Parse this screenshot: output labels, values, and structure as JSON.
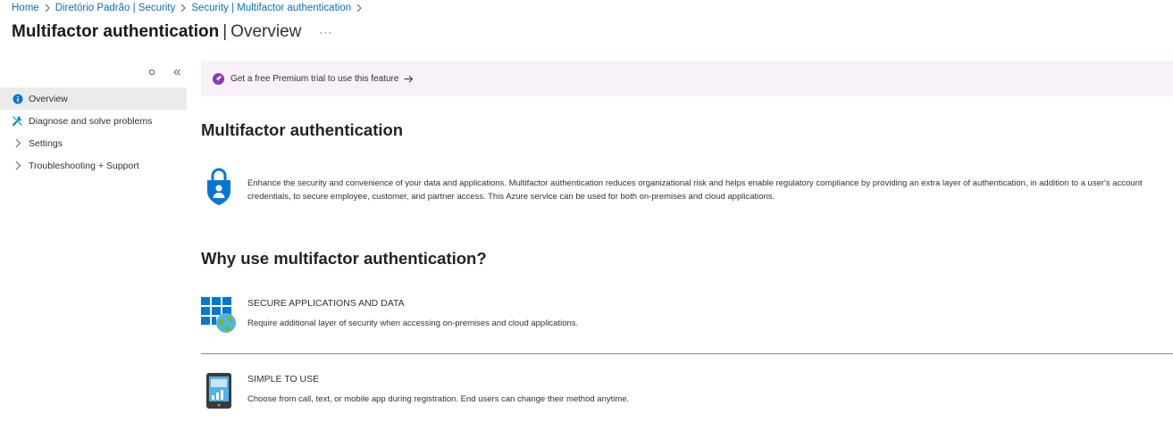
{
  "breadcrumb": {
    "items": [
      "Home",
      "Diretório Padrão | Security",
      "Security | Multifactor authentication"
    ]
  },
  "header": {
    "title": "Multifactor authentication",
    "separator": "|",
    "subtitle": "Overview",
    "more": "···"
  },
  "sidebar": {
    "controls": [
      {
        "icon": "refresh-icon"
      },
      {
        "icon": "collapse-double-chevron-icon"
      }
    ],
    "items": [
      {
        "label": "Overview",
        "icon": "info-icon",
        "active": true
      },
      {
        "label": "Diagnose and solve problems",
        "icon": "wrench-icon",
        "active": false
      },
      {
        "label": "Settings",
        "icon": "chevron-right-icon",
        "active": false
      },
      {
        "label": "Troubleshooting + Support",
        "icon": "chevron-right-icon",
        "active": false
      }
    ]
  },
  "banner": {
    "text": "Get a free Premium trial to use this feature",
    "icon": "rocket-icon",
    "arrow_icon": "arrow-right-icon"
  },
  "main": {
    "heading": "Multifactor authentication",
    "intro_icon": "shield-lock-user-icon",
    "intro_text": "Enhance the security and convenience of your data and applications. Multifactor authentication reduces organizational risk and helps enable regulatory compliance by providing an extra layer of authentication, in addition to a user's account credentials, to secure employee, customer, and partner access. This Azure service can be used for both on-premises and cloud applications.",
    "why_heading": "Why use multifactor authentication?",
    "features": [
      {
        "icon": "apps-globe-icon",
        "title": "SECURE APPLICATIONS AND DATA",
        "description": "Require additional layer of security when accessing on-premises and cloud applications."
      },
      {
        "icon": "mobile-device-icon",
        "title": "SIMPLE TO USE",
        "description": "Choose from call, text, or mobile app during registration. End users can change their method anytime."
      }
    ]
  },
  "colors": {
    "link": "#0f6cbd",
    "banner_bg": "#f8f1fa",
    "banner_icon": "#8a3bb8",
    "active_nav_bg": "#edebe9",
    "azure_blue": "#0078d4"
  }
}
